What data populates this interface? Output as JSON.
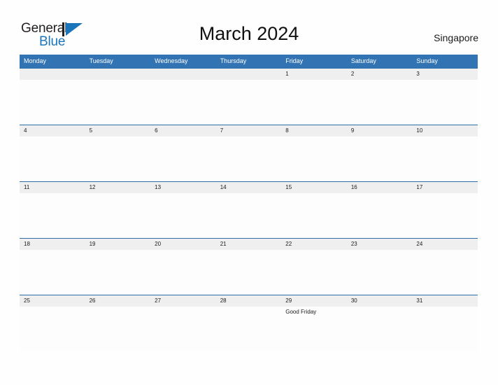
{
  "brand": {
    "name_top": "General",
    "name_bottom": "Blue",
    "flag_icon": "blue-flag-triangle",
    "color_dark": "#231F20",
    "color_blue": "#1B75BB"
  },
  "header": {
    "title": "March 2024",
    "locale": "Singapore"
  },
  "theme": {
    "header_blue": "#3173B3",
    "row_divider_blue": "#2E6DA8",
    "date_strip_gray": "#EFEFEF",
    "page_background": "#FEFEFE",
    "text_dark": "#1A1A1A"
  },
  "calendar": {
    "weekdays": [
      "Monday",
      "Tuesday",
      "Wednesday",
      "Thursday",
      "Friday",
      "Saturday",
      "Sunday"
    ],
    "weeks": [
      {
        "days": [
          {
            "date": "",
            "event": ""
          },
          {
            "date": "",
            "event": ""
          },
          {
            "date": "",
            "event": ""
          },
          {
            "date": "",
            "event": ""
          },
          {
            "date": "1",
            "event": ""
          },
          {
            "date": "2",
            "event": ""
          },
          {
            "date": "3",
            "event": ""
          }
        ]
      },
      {
        "days": [
          {
            "date": "4",
            "event": ""
          },
          {
            "date": "5",
            "event": ""
          },
          {
            "date": "6",
            "event": ""
          },
          {
            "date": "7",
            "event": ""
          },
          {
            "date": "8",
            "event": ""
          },
          {
            "date": "9",
            "event": ""
          },
          {
            "date": "10",
            "event": ""
          }
        ]
      },
      {
        "days": [
          {
            "date": "11",
            "event": ""
          },
          {
            "date": "12",
            "event": ""
          },
          {
            "date": "13",
            "event": ""
          },
          {
            "date": "14",
            "event": ""
          },
          {
            "date": "15",
            "event": ""
          },
          {
            "date": "16",
            "event": ""
          },
          {
            "date": "17",
            "event": ""
          }
        ]
      },
      {
        "days": [
          {
            "date": "18",
            "event": ""
          },
          {
            "date": "19",
            "event": ""
          },
          {
            "date": "20",
            "event": ""
          },
          {
            "date": "21",
            "event": ""
          },
          {
            "date": "22",
            "event": ""
          },
          {
            "date": "23",
            "event": ""
          },
          {
            "date": "24",
            "event": ""
          }
        ]
      },
      {
        "days": [
          {
            "date": "25",
            "event": ""
          },
          {
            "date": "26",
            "event": ""
          },
          {
            "date": "27",
            "event": ""
          },
          {
            "date": "28",
            "event": ""
          },
          {
            "date": "29",
            "event": "Good Friday"
          },
          {
            "date": "30",
            "event": ""
          },
          {
            "date": "31",
            "event": ""
          }
        ]
      }
    ]
  }
}
